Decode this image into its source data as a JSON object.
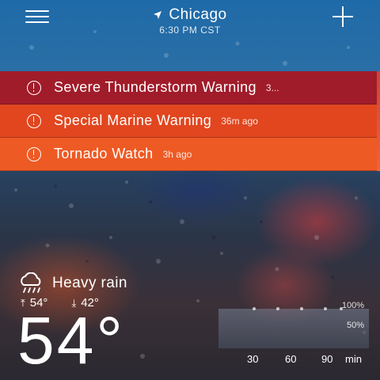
{
  "header": {
    "menu_icon": "hamburger-menu-icon",
    "location_icon": "navigation-arrow-icon",
    "city": "Chicago",
    "time": "6:30 PM CST",
    "add_icon": "plus-icon"
  },
  "alerts": [
    {
      "title": "Severe Thunderstorm Warning",
      "time": "3...",
      "color": "#a11c2a"
    },
    {
      "title": "Special Marine Warning",
      "time": "36m ago",
      "color": "#e1461f"
    },
    {
      "title": "Tornado Watch",
      "time": "3h ago",
      "color": "#ee5a24"
    }
  ],
  "current": {
    "condition_icon": "heavy-rain-cloud-icon",
    "condition": "Heavy rain",
    "high": "54°",
    "low": "42°",
    "temperature": "54°"
  },
  "precipitation": {
    "pct_high": "100%",
    "pct_mid": "50%",
    "ticks": [
      "30",
      "60",
      "90",
      "min"
    ]
  }
}
